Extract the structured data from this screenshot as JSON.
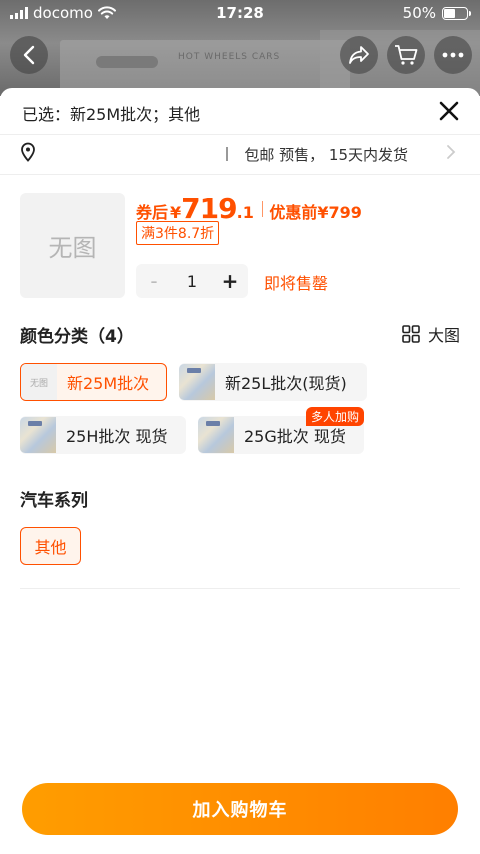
{
  "status_bar": {
    "carrier": "docomo",
    "time": "17:28",
    "battery": "50%"
  },
  "backdrop": {
    "box_text": "HOT WHEELS CARS"
  },
  "selected_text": "已选：新25M批次；其他",
  "shipping": {
    "free_shipping": "包邮",
    "presale": "预售，",
    "ship_time": "15天内发货"
  },
  "thumbnail_text": "无图",
  "price": {
    "after_coupon_label": "券后",
    "currency": "¥",
    "integer": "719",
    "decimal": ".1",
    "before_label": "优惠前",
    "before_price": "¥799"
  },
  "promo": "满3件8.7折",
  "quantity": {
    "minus": "-",
    "value": "1",
    "plus": "+"
  },
  "stock_status": "即将售罄",
  "color_section": {
    "title": "颜色分类（4）",
    "big_view_label": "大图",
    "options": [
      {
        "label": "新25M批次",
        "thumb_text": "无图",
        "selected": true
      },
      {
        "label": "新25L批次(现货)",
        "selected": false
      },
      {
        "label": "25H批次 现货",
        "selected": false
      },
      {
        "label": "25G批次 现货",
        "badge": "多人加购",
        "selected": false
      }
    ]
  },
  "series_section": {
    "title": "汽车系列",
    "options": [
      {
        "label": "其他",
        "selected": true
      }
    ]
  },
  "add_to_cart": "加入购物车",
  "colors": {
    "accent": "#ff5000",
    "button_start": "#ff9d00",
    "button_end": "#ff7f00"
  }
}
